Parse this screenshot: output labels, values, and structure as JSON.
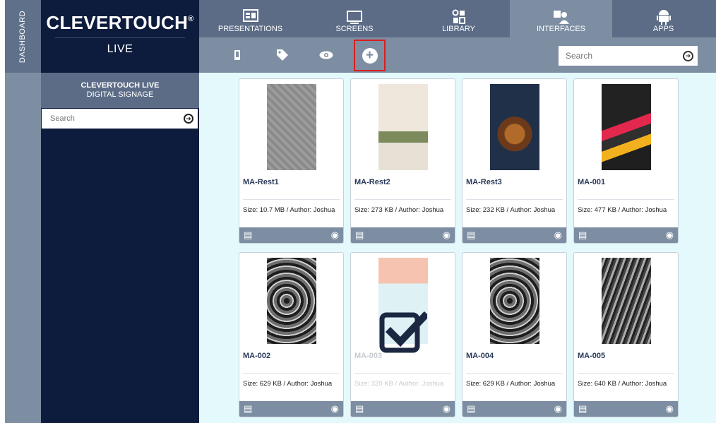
{
  "sidebar_tab": {
    "label": "DASHBOARD"
  },
  "brand": {
    "name": "CLEVERTOUCH",
    "registered": "®",
    "sub": "LIVE"
  },
  "sidebar": {
    "title_line1": "CLEVERTOUCH LIVE",
    "title_line2": "DIGITAL SIGNAGE",
    "search_placeholder": "Search",
    "search_go_icon": "arrow-circle-right-icon"
  },
  "nav": {
    "active": "INTERFACES",
    "tabs": [
      {
        "label": "PRESENTATIONS",
        "icon": "presentation-icon"
      },
      {
        "label": "SCREENS",
        "icon": "monitor-icon"
      },
      {
        "label": "LIBRARY",
        "icon": "library-icon"
      },
      {
        "label": "INTERFACES",
        "icon": "interfaces-icon"
      },
      {
        "label": "APPS",
        "icon": "android-icon"
      }
    ]
  },
  "toolbar": {
    "icons": [
      "phone-icon",
      "tag-icon",
      "eye-icon",
      "add-circle-icon"
    ],
    "search_placeholder": "Search",
    "highlight_color": "#d81e1e"
  },
  "cards": [
    {
      "name": "MA-Rest1",
      "meta": "Size: 10.7 MB / Author: Joshua"
    },
    {
      "name": "MA-Rest2",
      "meta": "Size: 273 KB / Author: Joshua"
    },
    {
      "name": "MA-Rest3",
      "meta": "Size: 232 KB / Author: Joshua"
    },
    {
      "name": "MA-001",
      "meta": "Size: 477 KB / Author: Joshua"
    },
    {
      "name": "MA-002",
      "meta": "Size: 629 KB / Author: Joshua"
    },
    {
      "name": "MA-003",
      "meta": "Size: 320 KB / Author: Joshua"
    },
    {
      "name": "MA-004",
      "meta": "Size: 629 KB / Author: Joshua"
    },
    {
      "name": "MA-005",
      "meta": "Size: 640 KB / Author: Joshua"
    }
  ],
  "colors": {
    "navy": "#0d1b3d",
    "slate": "#5c6c86",
    "slate_light": "#7d8ea3",
    "content_bg": "#e4f9fb"
  }
}
